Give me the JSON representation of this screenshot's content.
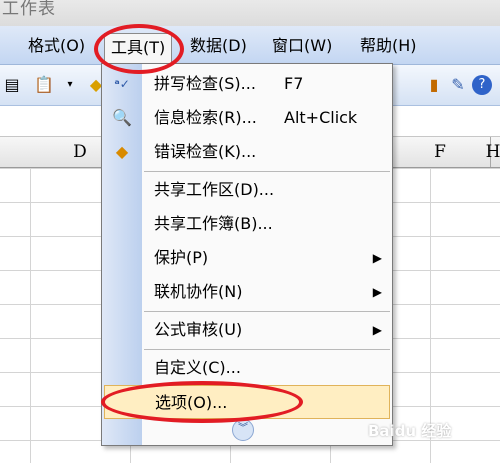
{
  "window": {
    "title": "工作表"
  },
  "menubar": {
    "items": [
      {
        "label": "格式(O)"
      },
      {
        "label": "工具(T)"
      },
      {
        "label": "数据(D)"
      },
      {
        "label": "窗口(W)"
      },
      {
        "label": "帮助(H)"
      }
    ]
  },
  "sheet": {
    "column_headers": [
      "D",
      "F",
      "H"
    ]
  },
  "tools_menu": {
    "items": [
      {
        "label": "拼写检查(S)...",
        "shortcut": "F7",
        "icon": "spell-check-icon"
      },
      {
        "label": "信息检索(R)...",
        "shortcut": "Alt+Click",
        "icon": "research-icon"
      },
      {
        "label": "错误检查(K)...",
        "shortcut": "",
        "icon": "error-check-icon"
      },
      {
        "label": "共享工作区(D)...",
        "shortcut": ""
      },
      {
        "label": "共享工作簿(B)...",
        "shortcut": ""
      },
      {
        "label": "保护(P)",
        "submenu": true
      },
      {
        "label": "联机协作(N)",
        "submenu": true
      },
      {
        "label": "公式审核(U)",
        "submenu": true
      },
      {
        "label": "自定义(C)..."
      },
      {
        "label": "选项(O)...",
        "highlighted": true
      }
    ],
    "expand_icon": "double-chevron-down-icon"
  },
  "annotations": {
    "color": "#e21c24",
    "circled": [
      "工具(T)",
      "选项(O)..."
    ]
  },
  "watermark": {
    "text": "Baidu 经验"
  }
}
